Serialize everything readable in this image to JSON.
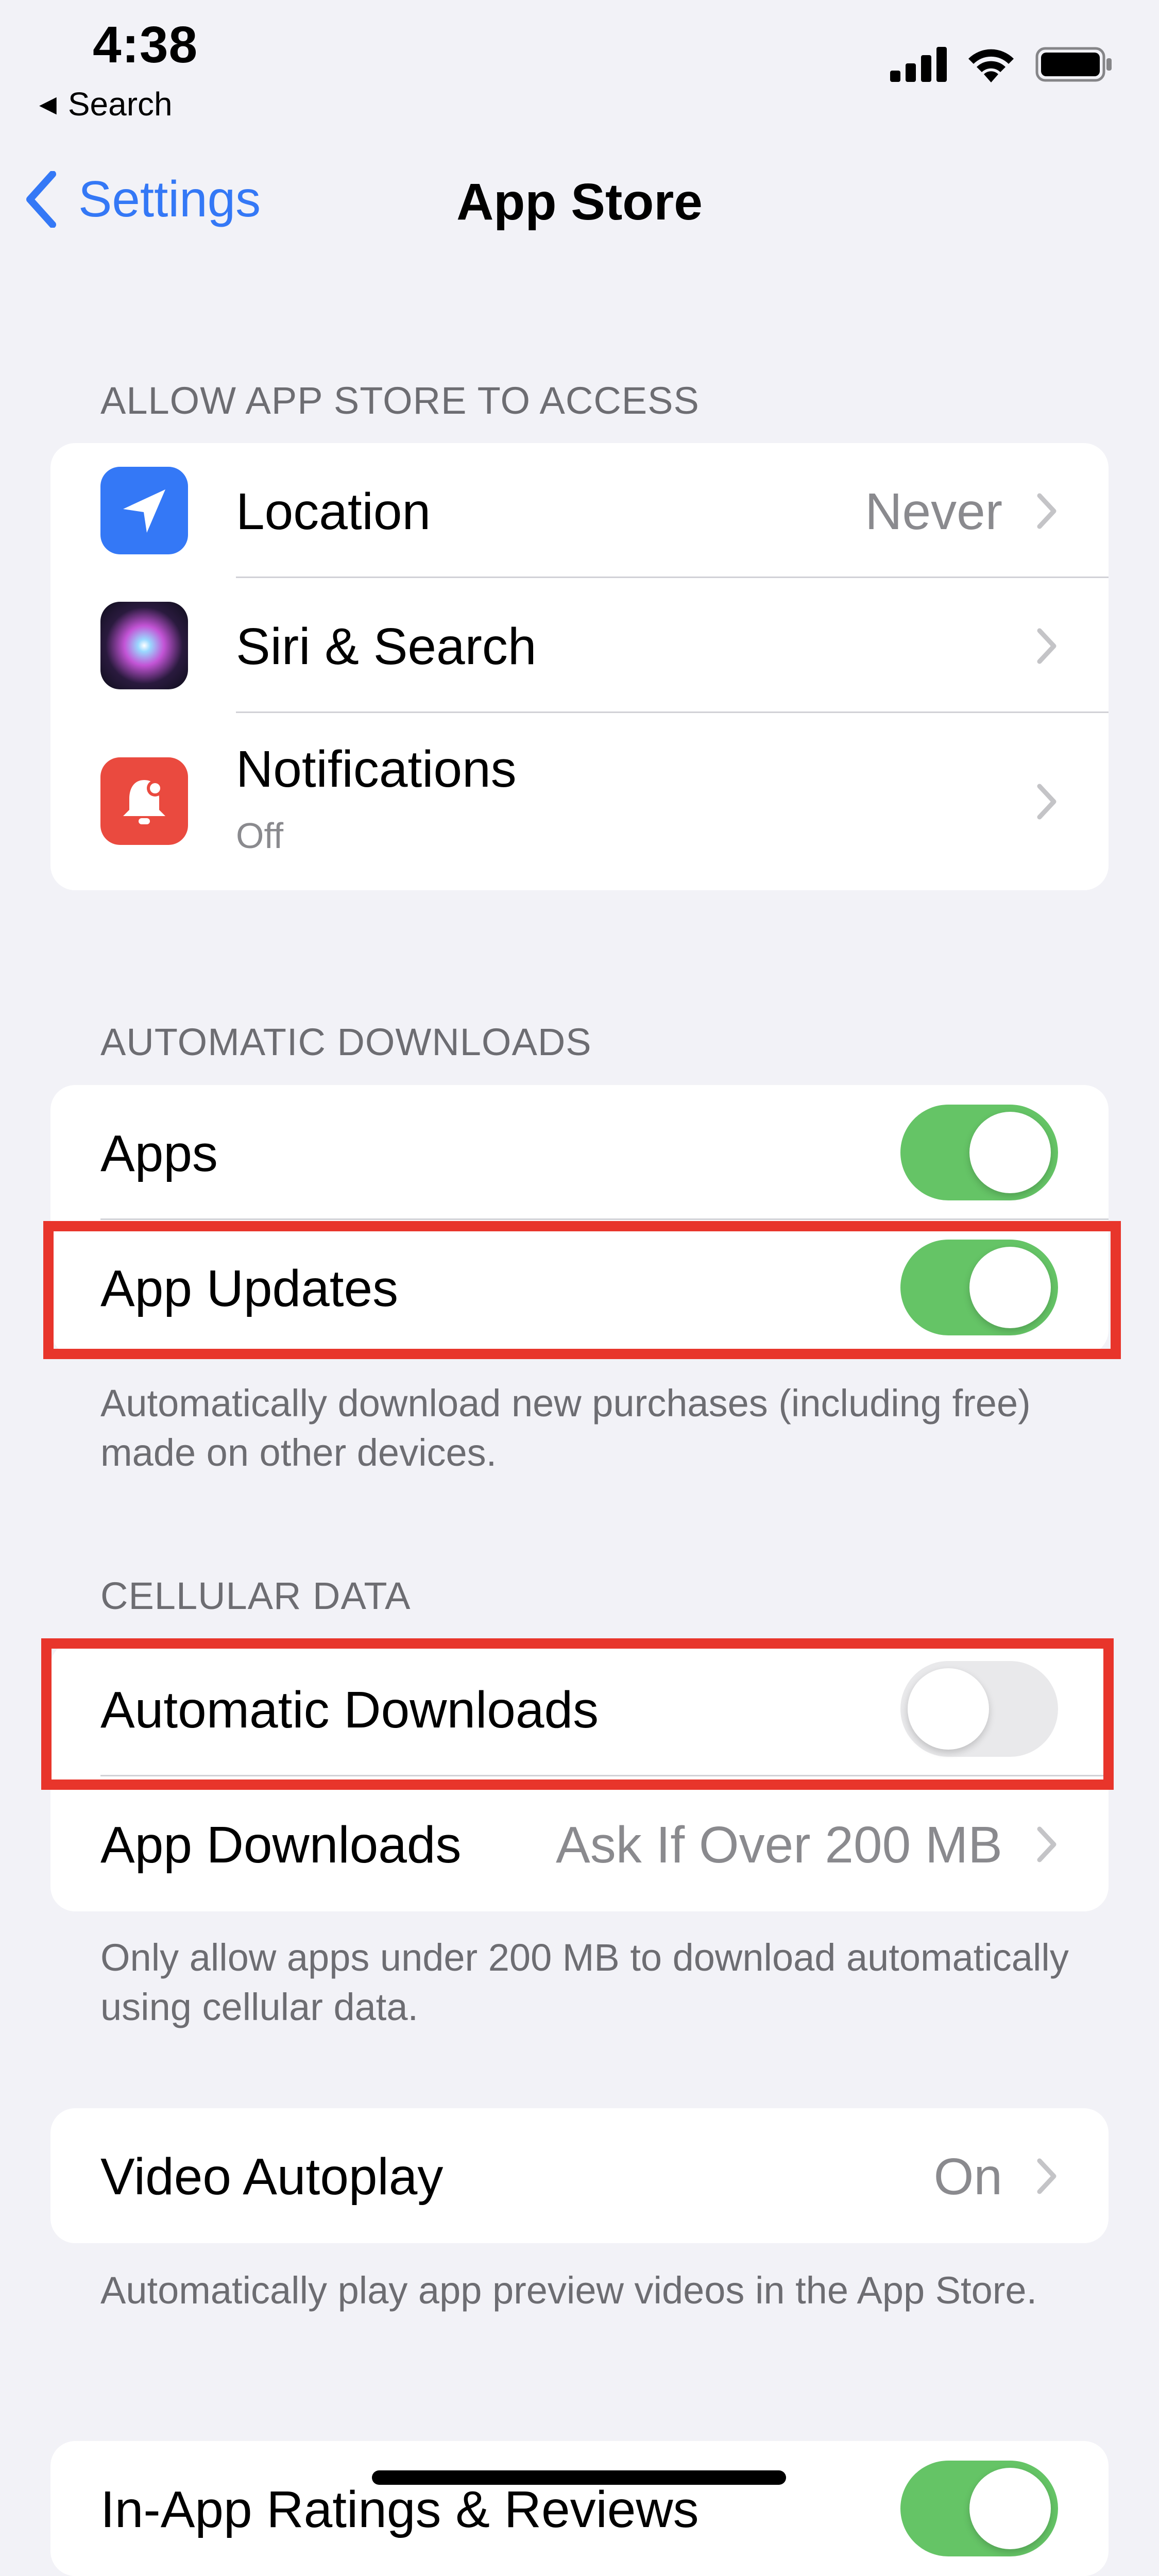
{
  "status_bar": {
    "time": "4:38",
    "back_label": "Search"
  },
  "nav": {
    "back_label": "Settings",
    "title": "App Store"
  },
  "section_access": {
    "header": "ALLOW APP STORE TO ACCESS",
    "items": [
      {
        "label": "Location",
        "value": "Never",
        "icon": "location-arrow-icon",
        "icon_color": "#3478f6"
      },
      {
        "label": "Siri & Search",
        "value": "",
        "icon": "siri-icon",
        "icon_color": "#1a1a2e"
      },
      {
        "label": "Notifications",
        "sublabel": "Off",
        "icon": "notification-bell-icon",
        "icon_color": "#ea4a3f"
      }
    ]
  },
  "section_auto": {
    "header": "AUTOMATIC DOWNLOADS",
    "items": [
      {
        "label": "Apps",
        "toggle": "on"
      },
      {
        "label": "App Updates",
        "toggle": "on"
      }
    ],
    "footer": "Automatically download new purchases (including free) made on other devices."
  },
  "section_cellular": {
    "header": "CELLULAR DATA",
    "items": [
      {
        "label": "Automatic Downloads",
        "toggle": "off"
      },
      {
        "label": "App Downloads",
        "value": "Ask If Over 200 MB"
      }
    ],
    "footer": "Only allow apps under 200 MB to download automatically using cellular data."
  },
  "section_video": {
    "items": [
      {
        "label": "Video Autoplay",
        "value": "On"
      }
    ],
    "footer": "Automatically play app preview videos in the App Store."
  },
  "section_ratings": {
    "items": [
      {
        "label": "In-App Ratings & Reviews",
        "toggle": "on"
      }
    ]
  },
  "colors": {
    "accent": "#3478f6",
    "toggle_on": "#65c466",
    "toggle_off": "#e9e9eb",
    "highlight": "#e8352b",
    "background": "#f2f2f7"
  }
}
